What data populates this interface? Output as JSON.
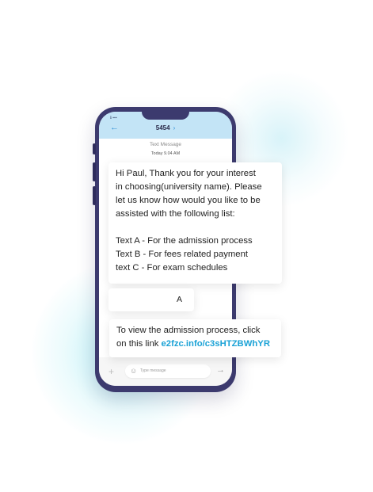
{
  "header": {
    "status_text": "ℹ ▪▪▪",
    "contact": "5454",
    "subtitle": "Text Message",
    "timestamp": "Today 9.04 AM"
  },
  "messages": {
    "incoming_1": {
      "lines": [
        "Hi Paul, Thank you for your interest",
        "in choosing(university name). Please",
        "let us know how would you like to be",
        "assisted with the following list:"
      ],
      "options": [
        "Text A - For the admission process",
        "Text B - For fees related payment",
        "text C - For exam schedules"
      ]
    },
    "reply": "A",
    "incoming_2": {
      "line1": "To view the admission process, click",
      "line2_prefix": "on this link ",
      "link_text": "e2fzc.info/c3sHTZBWhYR"
    }
  },
  "input": {
    "placeholder": "Type message"
  },
  "icons": {
    "back": "arrow-left-icon",
    "chevron": "chevron-right-icon",
    "plus": "plus-icon",
    "emoji": "smiley-icon",
    "send": "arrow-right-icon"
  },
  "colors": {
    "phone_frame": "#3c3a6e",
    "header_bg": "#c3e4f6",
    "accent": "#2f8fd6",
    "link": "#1aa2d6"
  }
}
